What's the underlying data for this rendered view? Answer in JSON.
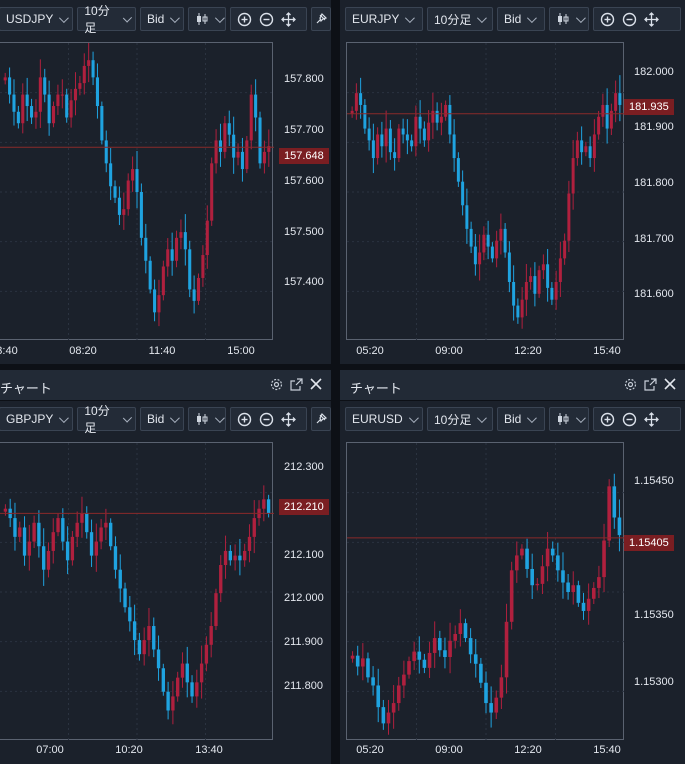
{
  "colors": {
    "up": "#b0203e",
    "down": "#1fa3e0",
    "price_line": "#8a2a2a"
  },
  "icons": [
    "candlestick-icon",
    "zoom-in-icon",
    "zoom-out-icon",
    "move-icon",
    "pin-icon",
    "gear-icon",
    "external-link-icon",
    "close-icon",
    "chevron-down-icon"
  ],
  "panels": [
    {
      "title": "",
      "symbol": "USDJPY",
      "timeframe": "10分足",
      "price_type": "Bid",
      "current_price": "157.648",
      "y_ticks": [
        "157.800",
        "157.700",
        "157.600",
        "157.500",
        "157.400"
      ],
      "x_ticks": [
        "3:40",
        "08:20",
        "11:40",
        "15:00"
      ]
    },
    {
      "title": "",
      "symbol": "EURJPY",
      "timeframe": "10分足",
      "price_type": "Bid",
      "current_price": "181.935",
      "y_ticks": [
        "182.000",
        "181.900",
        "181.800",
        "181.700",
        "181.600"
      ],
      "x_ticks": [
        "05:20",
        "09:00",
        "12:20",
        "15:40"
      ]
    },
    {
      "title": "チャート",
      "symbol": "GBPJPY",
      "timeframe": "10分足",
      "price_type": "Bid",
      "current_price": "212.210",
      "y_ticks": [
        "212.300",
        "212.100",
        "212.000",
        "211.900",
        "211.800"
      ],
      "x_ticks": [
        "07:00",
        "10:20",
        "13:40"
      ]
    },
    {
      "title": "チャート",
      "symbol": "EURUSD",
      "timeframe": "10分足",
      "price_type": "Bid",
      "current_price": "1.15405",
      "y_ticks": [
        "1.15450",
        "1.15350",
        "1.15300"
      ],
      "x_ticks": [
        "05:20",
        "09:00",
        "12:20",
        "15:40"
      ]
    }
  ],
  "chart_data": [
    {
      "type": "candlestick",
      "symbol": "USDJPY",
      "ylim": [
        157.31,
        157.83
      ],
      "current": 157.648,
      "x_tick_labels": [
        "3:40",
        "08:20",
        "11:40",
        "15:00"
      ],
      "close": [
        157.77,
        157.74,
        157.71,
        157.69,
        157.74,
        157.72,
        157.7,
        157.71,
        157.77,
        157.74,
        157.69,
        157.72,
        157.74,
        157.74,
        157.7,
        157.73,
        157.75,
        157.76,
        157.79,
        157.8,
        157.77,
        157.72,
        157.66,
        157.62,
        157.58,
        157.56,
        157.53,
        157.54,
        157.59,
        157.61,
        157.57,
        157.49,
        157.45,
        157.4,
        157.36,
        157.39,
        157.44,
        157.47,
        157.45,
        157.49,
        157.5,
        157.47,
        157.4,
        157.38,
        157.42,
        157.46,
        157.52,
        157.62,
        157.66,
        157.64,
        157.69,
        157.67,
        157.63,
        157.64,
        157.61,
        157.66,
        157.74,
        157.7,
        157.62,
        157.64,
        157.65
      ]
    },
    {
      "type": "candlestick",
      "symbol": "EURJPY",
      "ylim": [
        181.55,
        182.055
      ],
      "current": 181.935,
      "x_tick_labels": [
        "05:20",
        "09:00",
        "12:20",
        "15:40"
      ],
      "close": [
        181.94,
        181.97,
        181.95,
        181.91,
        181.89,
        181.86,
        181.9,
        181.88,
        181.91,
        181.87,
        181.86,
        181.91,
        181.9,
        181.89,
        181.88,
        181.93,
        181.91,
        181.89,
        181.92,
        181.94,
        181.92,
        181.93,
        181.95,
        181.9,
        181.86,
        181.82,
        181.78,
        181.74,
        181.71,
        181.68,
        181.7,
        181.73,
        181.71,
        181.69,
        181.72,
        181.74,
        181.7,
        181.65,
        181.61,
        181.59,
        181.62,
        181.65,
        181.66,
        181.63,
        181.67,
        181.68,
        181.64,
        181.62,
        181.65,
        181.69,
        181.72,
        181.8,
        181.86,
        181.89,
        181.87,
        181.88,
        181.86,
        181.9,
        181.93,
        181.95,
        181.91,
        181.94,
        181.97,
        181.95
      ]
    },
    {
      "type": "candlestick",
      "symbol": "GBPJPY",
      "ylim": [
        211.725,
        212.36
      ],
      "current": 212.21,
      "x_tick_labels": [
        "07:00",
        "10:20",
        "13:40"
      ],
      "close": [
        212.22,
        212.2,
        212.16,
        212.18,
        212.12,
        212.15,
        212.19,
        212.14,
        212.09,
        212.13,
        212.17,
        212.2,
        212.15,
        212.11,
        212.16,
        212.19,
        212.21,
        212.17,
        212.12,
        212.15,
        212.18,
        212.19,
        212.14,
        212.09,
        212.05,
        212.01,
        211.98,
        211.94,
        211.91,
        211.94,
        211.97,
        211.92,
        211.88,
        211.83,
        211.79,
        211.82,
        211.86,
        211.89,
        211.85,
        211.82,
        211.85,
        211.89,
        211.93,
        211.97,
        212.04,
        212.1,
        212.13,
        212.11,
        212.12,
        212.11,
        212.13,
        212.16,
        212.2,
        212.22,
        212.24,
        212.21
      ]
    },
    {
      "type": "candlestick",
      "symbol": "EURUSD",
      "ylim": [
        1.15255,
        1.15475
      ],
      "current": 1.15405,
      "x_tick_labels": [
        "05:20",
        "09:00",
        "12:20",
        "15:40"
      ],
      "close": [
        1.15318,
        1.1531,
        1.15316,
        1.15302,
        1.15296,
        1.1528,
        1.15268,
        1.15276,
        1.15283,
        1.15296,
        1.15304,
        1.15314,
        1.15321,
        1.15315,
        1.15309,
        1.1532,
        1.15331,
        1.15322,
        1.15317,
        1.15329,
        1.15334,
        1.15342,
        1.15331,
        1.15319,
        1.15312,
        1.15298,
        1.15283,
        1.15276,
        1.15287,
        1.15302,
        1.15343,
        1.15381,
        1.15392,
        1.15397,
        1.15382,
        1.1537,
        1.15371,
        1.15384,
        1.15397,
        1.15392,
        1.15381,
        1.15372,
        1.15365,
        1.1537,
        1.15357,
        1.15351,
        1.1536,
        1.15368,
        1.15376,
        1.15403,
        1.15443,
        1.1542,
        1.15407
      ]
    }
  ]
}
